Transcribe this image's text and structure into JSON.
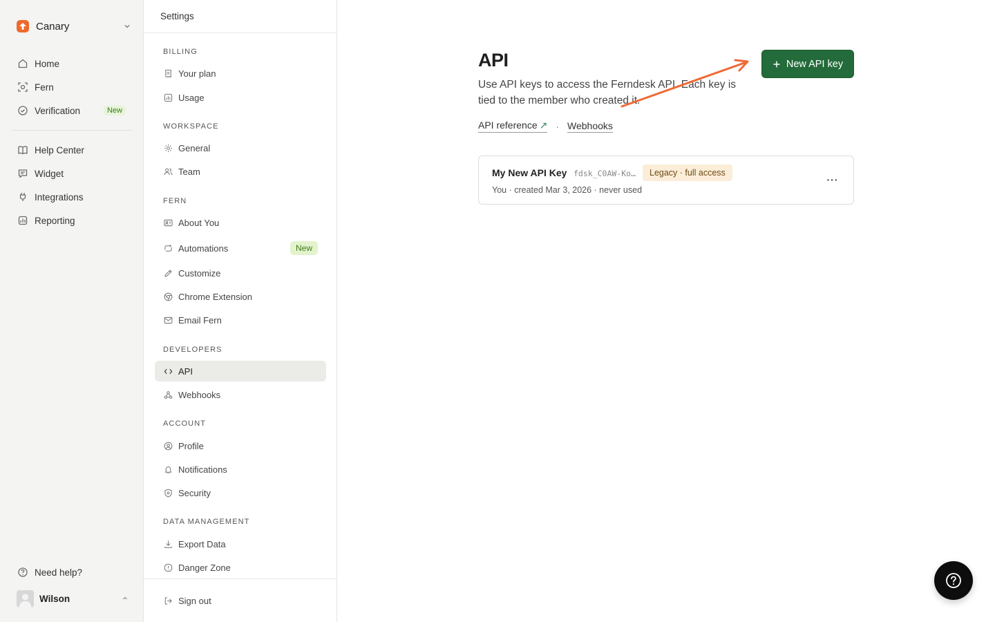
{
  "workspace": {
    "name": "Canary"
  },
  "app_nav": {
    "items": [
      {
        "label": "Home",
        "icon": "home-icon"
      },
      {
        "label": "Fern",
        "icon": "fern-icon"
      },
      {
        "label": "Verification",
        "icon": "check-circle-icon",
        "badge": "New"
      },
      {
        "label": "Help Center",
        "icon": "book-icon"
      },
      {
        "label": "Widget",
        "icon": "chat-icon"
      },
      {
        "label": "Integrations",
        "icon": "plug-icon"
      },
      {
        "label": "Reporting",
        "icon": "chart-icon"
      }
    ],
    "help_label": "Need help?"
  },
  "user": {
    "name": "Wilson"
  },
  "settings": {
    "title": "Settings",
    "groups": {
      "billing": "BILLING",
      "workspace": "WORKSPACE",
      "fern": "FERN",
      "developers": "DEVELOPERS",
      "account": "ACCOUNT",
      "data_management": "DATA MANAGEMENT"
    },
    "items": {
      "your_plan": "Your plan",
      "usage": "Usage",
      "general": "General",
      "team": "Team",
      "about_you": "About You",
      "automations": "Automations",
      "automations_badge": "New",
      "customize": "Customize",
      "chrome_extension": "Chrome Extension",
      "email_fern": "Email Fern",
      "api": "API",
      "webhooks": "Webhooks",
      "profile": "Profile",
      "notifications": "Notifications",
      "security": "Security",
      "export_data": "Export Data",
      "danger_zone": "Danger Zone"
    },
    "sign_out": "Sign out"
  },
  "main": {
    "title": "API",
    "description": "Use API keys to access the Ferndesk API. Each key is tied to the member who created it.",
    "api_reference_link": "API reference",
    "external_glyph": "↗",
    "separator": "·",
    "webhooks_link": "Webhooks",
    "new_key_button": "New API key",
    "keys": [
      {
        "name": "My New API Key",
        "prefix": "fdsk_C0AW-Ko…",
        "badge": "Legacy · full access",
        "meta": "You · created Mar 3, 2026 · never used",
        "menu": "···"
      }
    ]
  },
  "colors": {
    "accent_green": "#236b3a",
    "brand_orange": "#ee6a2c",
    "annotation_arrow": "#ee6a35",
    "legacy_badge_bg": "#fbedd8",
    "new_badge_bg": "#e3f3cc"
  }
}
